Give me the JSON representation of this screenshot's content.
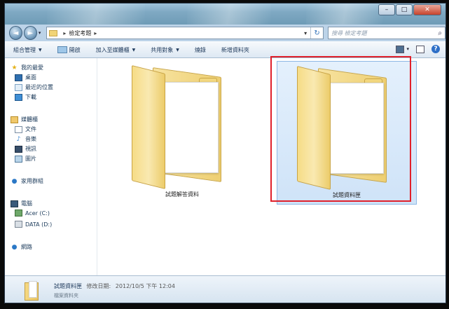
{
  "address": {
    "path_segments": [
      "檢定考題"
    ],
    "search_placeholder": "搜尋 檢定考題"
  },
  "toolbar": {
    "organize": "組合管理",
    "open": "開啟",
    "add_to_library": "加入至媒體櫃",
    "share_with": "共用對象",
    "burn": "燒錄",
    "new_folder": "新增資料夾"
  },
  "nav": {
    "favorites": "我的最愛",
    "desktop": "桌面",
    "recent": "最近的位置",
    "downloads": "下載",
    "libraries": "媒體櫃",
    "documents": "文件",
    "music": "音樂",
    "videos": "視訊",
    "pictures": "圖片",
    "homegroup": "家用群組",
    "computer": "電腦",
    "drive_c": "Acer (C:)",
    "drive_d": "DATA (D:)",
    "network": "網路"
  },
  "files": [
    {
      "name": "試題解答資料"
    },
    {
      "name": "試題資料匣"
    }
  ],
  "status": {
    "selected_name": "試題資料匣",
    "modified_label": "修改日期:",
    "modified_value": "2012/10/5 下午 12:04",
    "type": "檔案資料夾"
  },
  "colors": {
    "highlight_box": "#e0202a",
    "selection_bg": "#cfe3f8"
  }
}
